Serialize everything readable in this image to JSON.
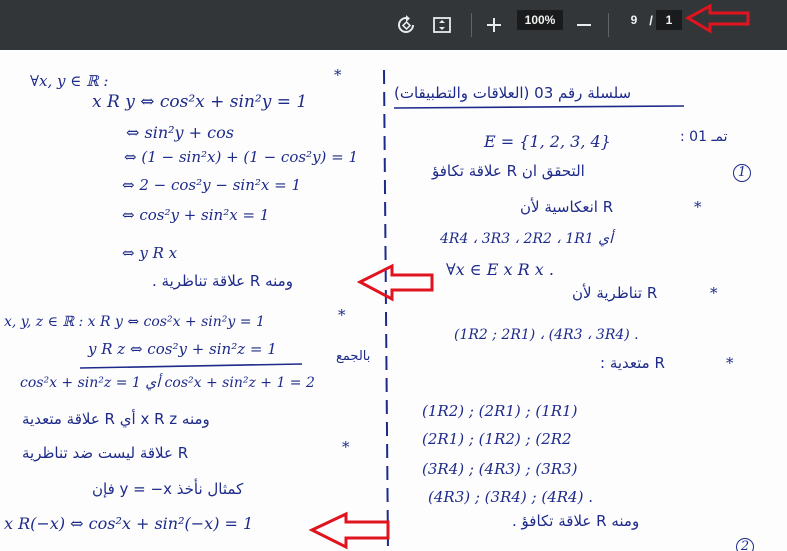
{
  "toolbar": {
    "zoom": "100%",
    "page_current": "9",
    "page_separator": "/",
    "page_total": "1",
    "icons": [
      "rotate-icon",
      "fit-page-icon",
      "zoom-in-icon",
      "zoom-out-icon"
    ]
  },
  "colors": {
    "toolbar_bg": "#323639",
    "ink": "#1d2a8a",
    "annotation_red": "#e0141e"
  },
  "left_column": {
    "lines": [
      "∀x, y ∈ ℝ :",
      "x R y ⇔ cos²x + sin²y = 1",
      "⇔ sin²y + cos",
      "⇔ (1 − sin²x) + (1 − cos²y) = 1",
      "⇔ 2 − cos²y − sin²x = 1",
      "⇔ cos²y + sin²x = 1",
      "⇔ y R x",
      "ومنه R علاقة تناظرية .",
      "x, y, z ∈ ℝ :   x R y ⇔ cos²x + sin²y = 1",
      "y R z ⇔ cos²y + sin²z = 1",
      "بالجمع",
      "cos²x + sin²z = 1   أي   cos²x + sin²z + 1 = 2",
      "ومنه   x R z   أي R علاقة متعدية",
      "R علاقة ليست ضد تناظرية",
      "كمثال نأخذ   y = −x   فإن",
      "x R(−x) ⇔ cos²x + sin²(−x) = 1"
    ],
    "asterisks": [
      "*",
      "*",
      "*"
    ]
  },
  "right_column": {
    "lines": [
      "سلسلة رقم 03 (العلاقات والتطبيقات)",
      "E = {1, 2, 3, 4}",
      "تمـ 01 :",
      "التحقق ان R علاقة تكافؤ",
      "R انعكاسية لأن",
      "4R4 ، 3R3 ، 2R2 ، 1R1   أي",
      "∀x ∈ E   x R x .",
      "R تناظرية لأن",
      "(1R2 ; 2R1) ، (4R3 ، 3R4) .",
      "R متعدية :",
      "(1R2) ; (2R1) ; (1R1)",
      "(2R1) ; (1R2) ; (2R2",
      "(3R4) ; (4R3) ; (3R3)",
      "(4R3) ; (3R4) ; (4R4) .",
      "ومنه R علاقة تكافؤ ."
    ],
    "asterisks": [
      "*",
      "*",
      "*"
    ],
    "circled_numbers": [
      "1",
      "2"
    ]
  }
}
